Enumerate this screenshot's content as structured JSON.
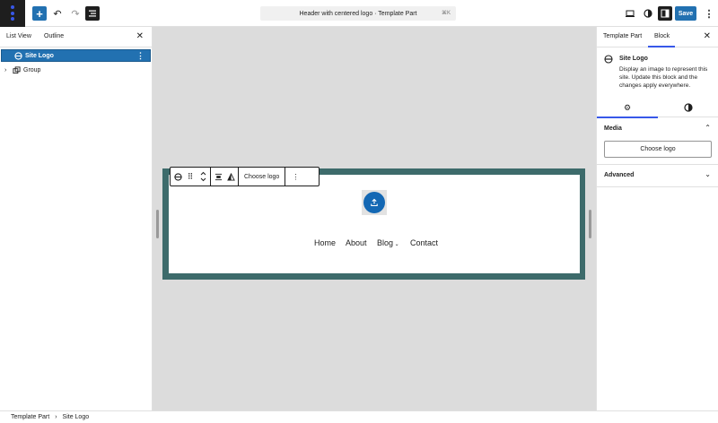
{
  "topbar": {
    "document_title": "Header with centered logo · Template Part",
    "shortcut": "⌘K",
    "save_label": "Save"
  },
  "left_sidebar": {
    "tabs": [
      "List View",
      "Outline"
    ],
    "items": [
      {
        "label": "Site Logo",
        "selected": true
      },
      {
        "label": "Group",
        "selected": false
      }
    ]
  },
  "block_toolbar": {
    "choose_logo_label": "Choose logo"
  },
  "canvas": {
    "nav_items": [
      "Home",
      "About",
      "Blog",
      "Contact"
    ],
    "frame_color": "#3d6b6b",
    "logo_button_color": "#1468b4"
  },
  "right_sidebar": {
    "tabs": [
      "Template Part",
      "Block"
    ],
    "block_title": "Site Logo",
    "block_description": "Display an image to represent this site. Update this block and the changes apply everywhere.",
    "media_panel_title": "Media",
    "choose_logo_label": "Choose logo",
    "advanced_panel_title": "Advanced"
  },
  "breadcrumb": [
    "Template Part",
    "Site Logo"
  ],
  "colors": {
    "accent": "#2271b1",
    "tab_indicator": "#3858e9"
  }
}
